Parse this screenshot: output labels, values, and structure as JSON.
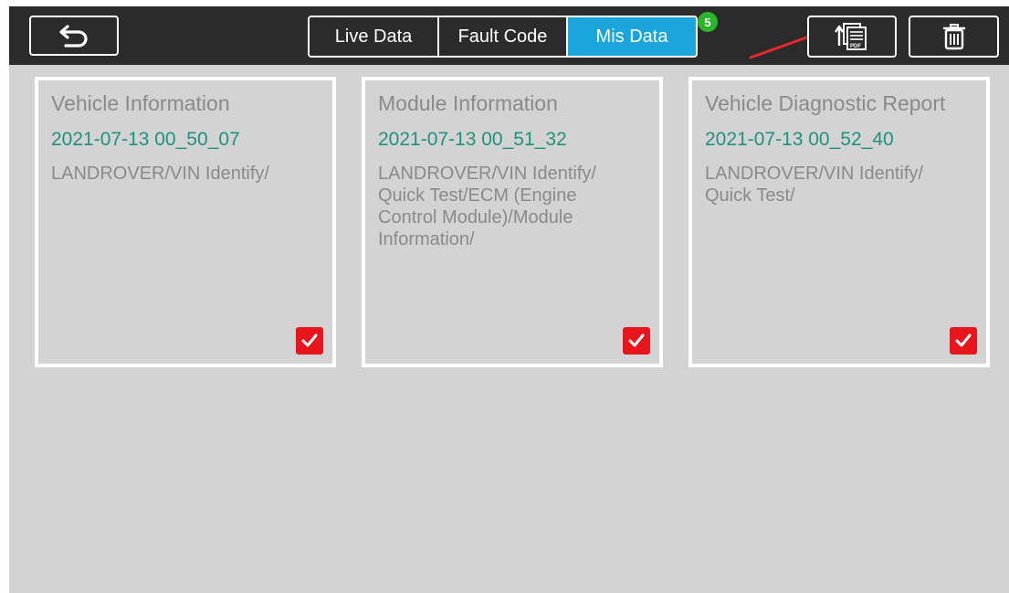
{
  "header": {
    "back_icon": "undo-arrow-icon",
    "tabs": [
      {
        "label": "Live Data",
        "active": false
      },
      {
        "label": "Fault Code",
        "active": false
      },
      {
        "label": "Mis Data",
        "active": true
      }
    ],
    "badge_count": "5",
    "export_pdf_icon": "export-pdf-icon",
    "delete_icon": "trash-icon"
  },
  "colors": {
    "topbar": "#2b2b2b",
    "active_tab": "#1aa6dc",
    "badge": "#2bb52b",
    "date_text": "#1e9281",
    "checkbox": "#e8161c",
    "annotation_arrow": "#e8282c",
    "background": "#d3d3d3"
  },
  "records": [
    {
      "title": "Vehicle Information",
      "timestamp": "2021-07-13 00_50_07",
      "path": "LANDROVER/VIN Identify/",
      "checked": true
    },
    {
      "title": "Module Information",
      "timestamp": "2021-07-13 00_51_32",
      "path": "LANDROVER/VIN Identify/\nQuick Test/ECM (Engine\nControl Module)/Module\nInformation/",
      "checked": true
    },
    {
      "title": "Vehicle Diagnostic Report",
      "timestamp": "2021-07-13 00_52_40",
      "path": "LANDROVER/VIN Identify/\nQuick Test/",
      "checked": true
    }
  ]
}
